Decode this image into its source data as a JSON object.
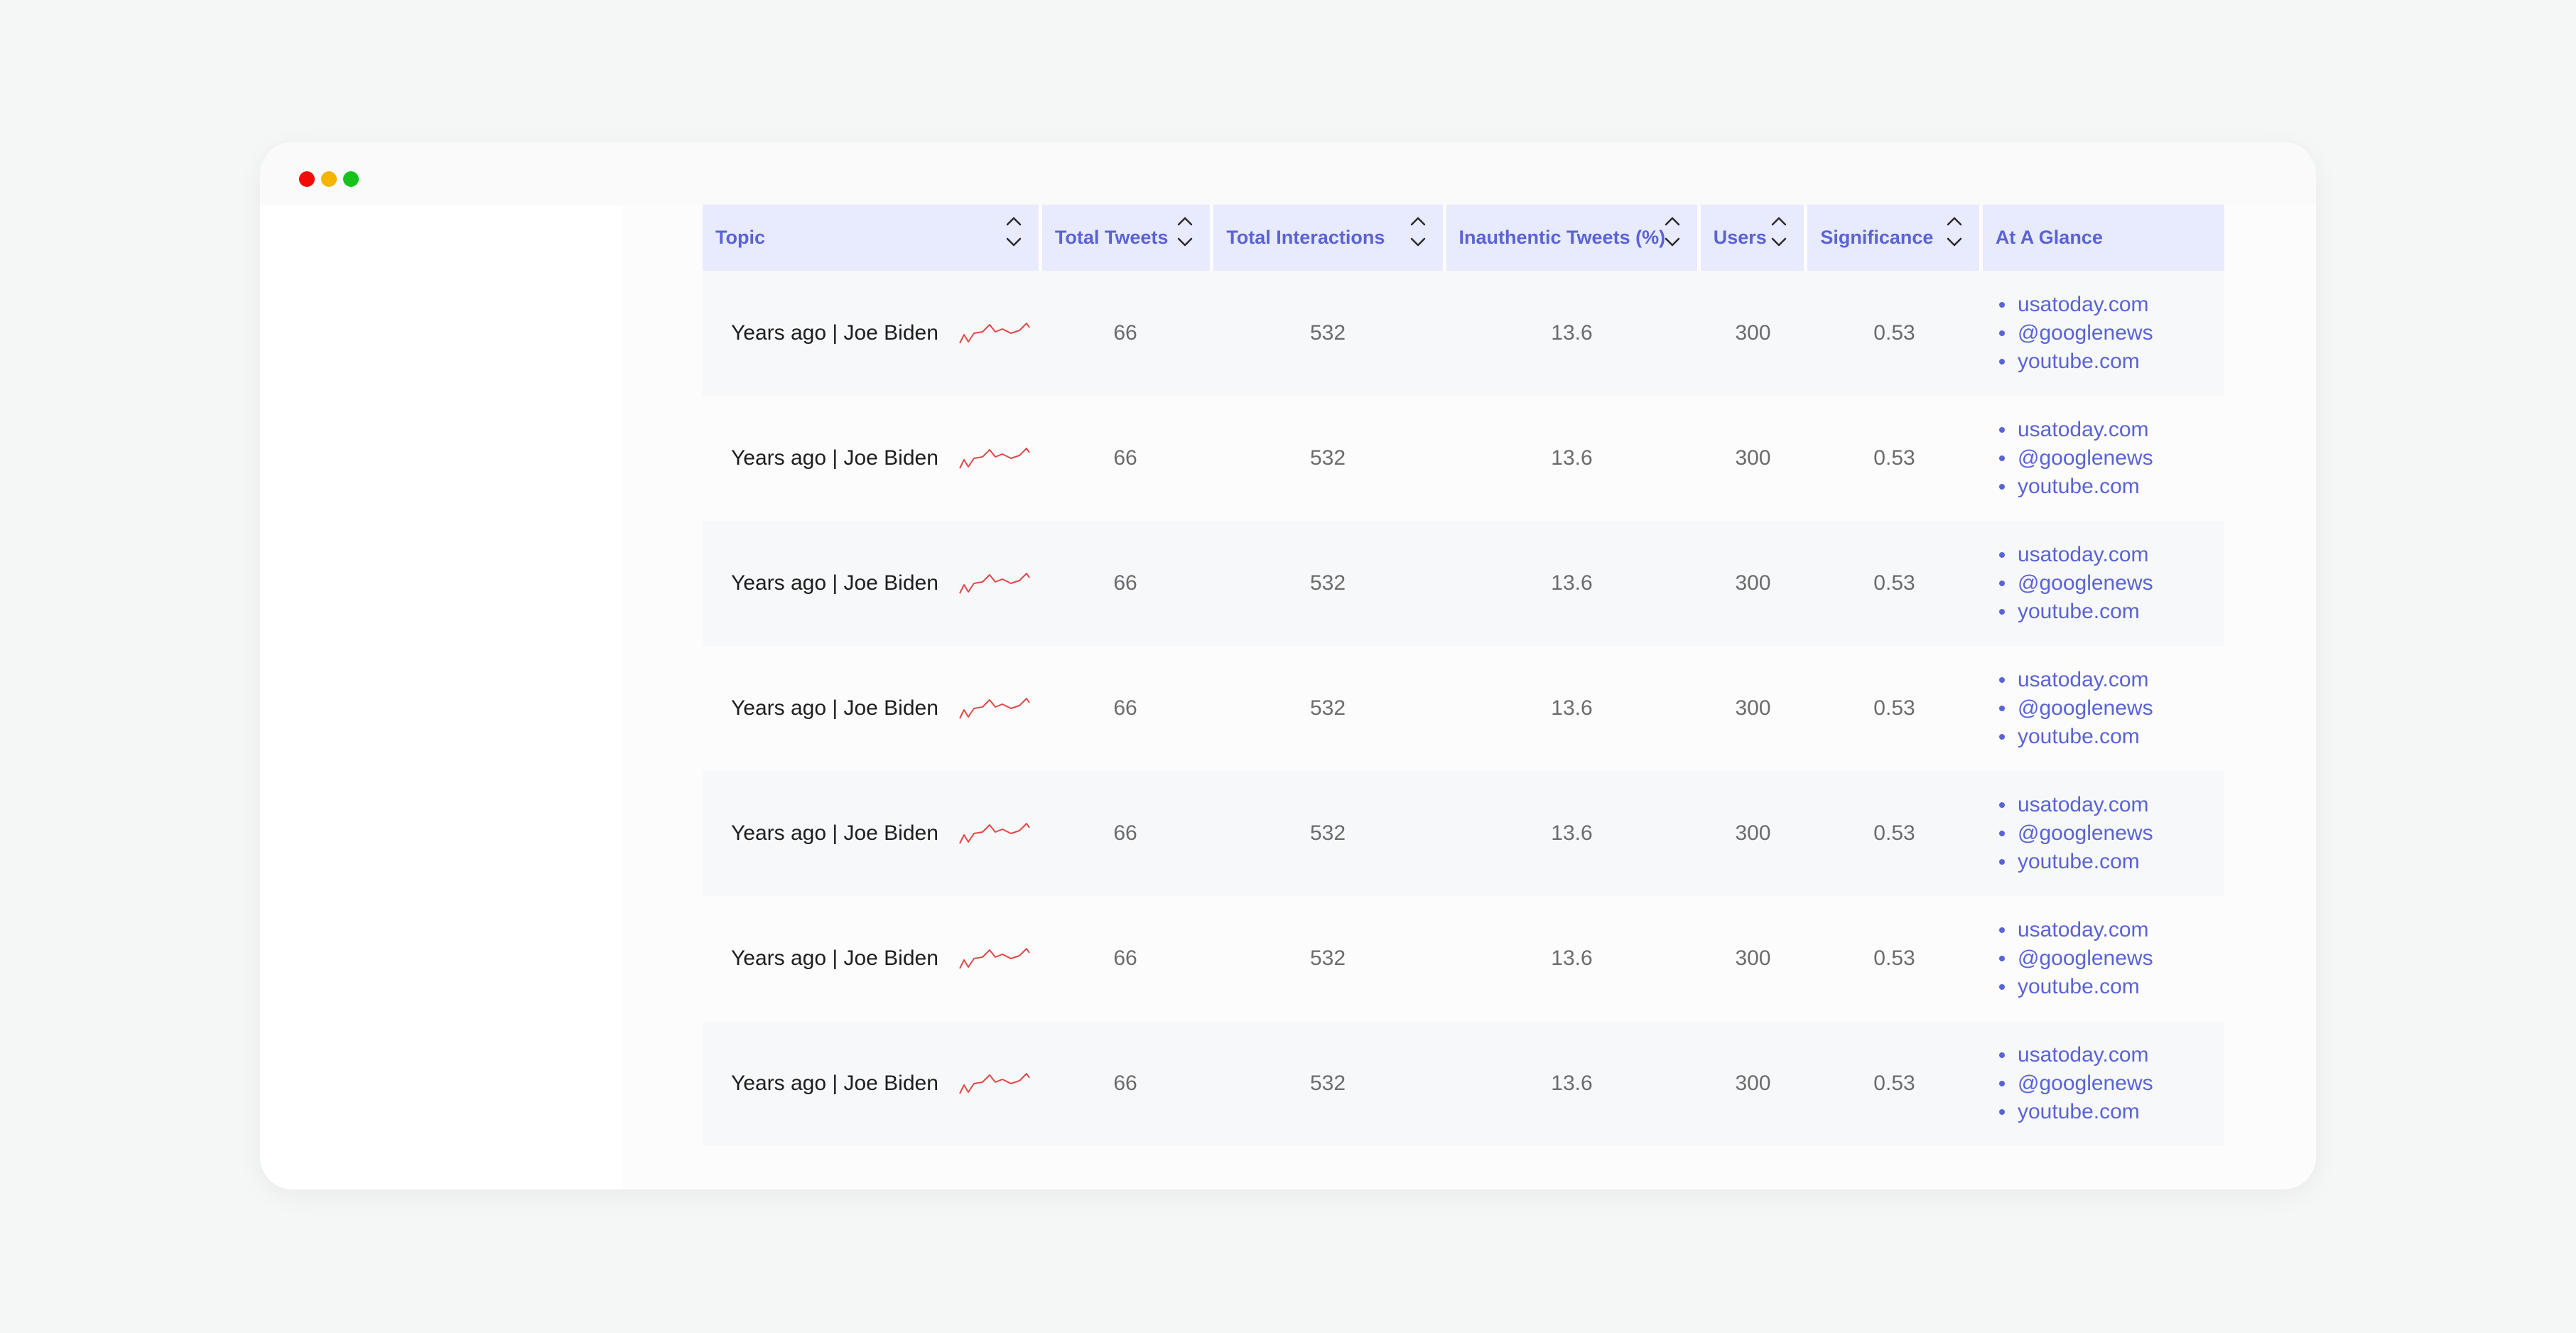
{
  "window": {
    "controls": [
      "close",
      "minimize",
      "maximize"
    ]
  },
  "colors": {
    "accent": "#5a63d6",
    "header_bg": "#e8eafd",
    "sparkline": "#e04848"
  },
  "table": {
    "columns": [
      {
        "label": "Topic",
        "sortable": true
      },
      {
        "label": "Total Tweets",
        "sortable": true
      },
      {
        "label": "Total Interactions",
        "sortable": true
      },
      {
        "label": "Inauthentic Tweets (%)",
        "sortable": true
      },
      {
        "label": "Users",
        "sortable": true
      },
      {
        "label": "Significance",
        "sortable": true
      },
      {
        "label": "At A Glance",
        "sortable": false
      }
    ],
    "rows": [
      {
        "topic": "Years ago | Joe Biden",
        "total_tweets": "66",
        "total_interactions": "532",
        "inauthentic": "13.6",
        "users": "300",
        "significance": "0.53",
        "glance": [
          "usatoday.com",
          "@googlenews",
          "youtube.com"
        ]
      },
      {
        "topic": "Years ago | Joe Biden",
        "total_tweets": "66",
        "total_interactions": "532",
        "inauthentic": "13.6",
        "users": "300",
        "significance": "0.53",
        "glance": [
          "usatoday.com",
          "@googlenews",
          "youtube.com"
        ]
      },
      {
        "topic": "Years ago | Joe Biden",
        "total_tweets": "66",
        "total_interactions": "532",
        "inauthentic": "13.6",
        "users": "300",
        "significance": "0.53",
        "glance": [
          "usatoday.com",
          "@googlenews",
          "youtube.com"
        ]
      },
      {
        "topic": "Years ago | Joe Biden",
        "total_tweets": "66",
        "total_interactions": "532",
        "inauthentic": "13.6",
        "users": "300",
        "significance": "0.53",
        "glance": [
          "usatoday.com",
          "@googlenews",
          "youtube.com"
        ]
      },
      {
        "topic": "Years ago | Joe Biden",
        "total_tweets": "66",
        "total_interactions": "532",
        "inauthentic": "13.6",
        "users": "300",
        "significance": "0.53",
        "glance": [
          "usatoday.com",
          "@googlenews",
          "youtube.com"
        ]
      },
      {
        "topic": "Years ago | Joe Biden",
        "total_tweets": "66",
        "total_interactions": "532",
        "inauthentic": "13.6",
        "users": "300",
        "significance": "0.53",
        "glance": [
          "usatoday.com",
          "@googlenews",
          "youtube.com"
        ]
      },
      {
        "topic": "Years ago | Joe Biden",
        "total_tweets": "66",
        "total_interactions": "532",
        "inauthentic": "13.6",
        "users": "300",
        "significance": "0.53",
        "glance": [
          "usatoday.com",
          "@googlenews",
          "youtube.com"
        ]
      }
    ]
  }
}
